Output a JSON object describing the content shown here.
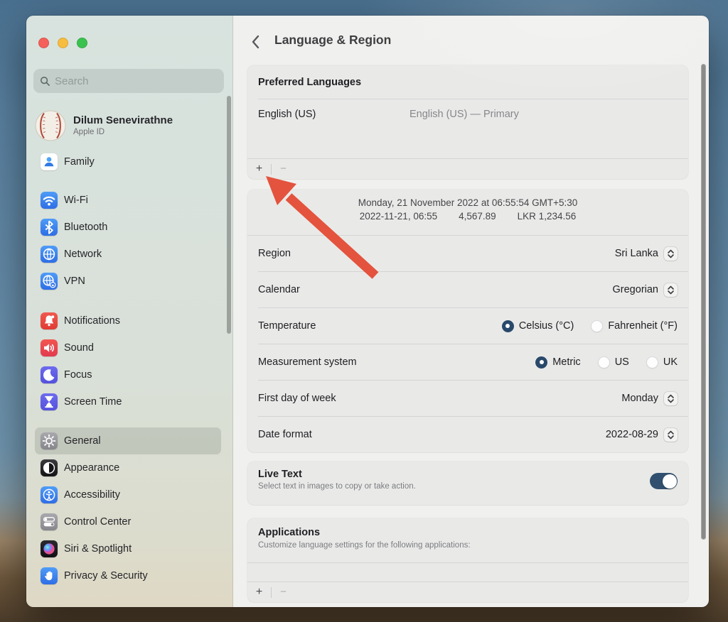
{
  "window": {
    "title": "Language & Region",
    "traffic_lights": [
      "close",
      "minimize",
      "zoom"
    ]
  },
  "sidebar": {
    "search_placeholder": "Search",
    "profile": {
      "name": "Dilum Senevirathne",
      "subtitle": "Apple ID"
    },
    "items": [
      {
        "id": "family",
        "label": "Family",
        "selected": false
      },
      {
        "id": "wifi",
        "label": "Wi-Fi",
        "selected": false
      },
      {
        "id": "bluetooth",
        "label": "Bluetooth",
        "selected": false
      },
      {
        "id": "network",
        "label": "Network",
        "selected": false
      },
      {
        "id": "vpn",
        "label": "VPN",
        "selected": false
      },
      {
        "id": "notifications",
        "label": "Notifications",
        "selected": false
      },
      {
        "id": "sound",
        "label": "Sound",
        "selected": false
      },
      {
        "id": "focus",
        "label": "Focus",
        "selected": false
      },
      {
        "id": "screen-time",
        "label": "Screen Time",
        "selected": false
      },
      {
        "id": "general",
        "label": "General",
        "selected": true
      },
      {
        "id": "appearance",
        "label": "Appearance",
        "selected": false
      },
      {
        "id": "accessibility",
        "label": "Accessibility",
        "selected": false
      },
      {
        "id": "control-center",
        "label": "Control Center",
        "selected": false
      },
      {
        "id": "siri-spotlight",
        "label": "Siri & Spotlight",
        "selected": false
      },
      {
        "id": "privacy-security",
        "label": "Privacy & Security",
        "selected": false
      }
    ]
  },
  "preferred_languages": {
    "section_title": "Preferred Languages",
    "language_name": "English (US)",
    "language_detail": "English (US) — Primary",
    "add_label": "+",
    "remove_label": "−"
  },
  "formats": {
    "preview_line1": "Monday, 21 November 2022 at 06:55:54 GMT+5:30",
    "preview_date_short": "2022-11-21, 06:55",
    "preview_number": "4,567.89",
    "preview_currency": "LKR 1,234.56",
    "region": {
      "label": "Region",
      "value": "Sri Lanka"
    },
    "calendar": {
      "label": "Calendar",
      "value": "Gregorian"
    },
    "temperature": {
      "label": "Temperature",
      "options": [
        {
          "label": "Celsius (°C)",
          "selected": true
        },
        {
          "label": "Fahrenheit (°F)",
          "selected": false
        }
      ]
    },
    "measurement": {
      "label": "Measurement system",
      "options": [
        {
          "label": "Metric",
          "selected": true
        },
        {
          "label": "US",
          "selected": false
        },
        {
          "label": "UK",
          "selected": false
        }
      ]
    },
    "first_day": {
      "label": "First day of week",
      "value": "Monday"
    },
    "date_format": {
      "label": "Date format",
      "value": "2022-08-29"
    }
  },
  "live_text": {
    "title": "Live Text",
    "description": "Select text in images to copy or take action.",
    "enabled": true
  },
  "applications": {
    "title": "Applications",
    "description": "Customize language settings for the following applications:",
    "add_label": "+",
    "remove_label": "−"
  },
  "colors": {
    "accent_control": "#29496b",
    "annotation_arrow": "#e4533d",
    "sidebar_selection": "rgba(70,80,70,0.16)"
  }
}
